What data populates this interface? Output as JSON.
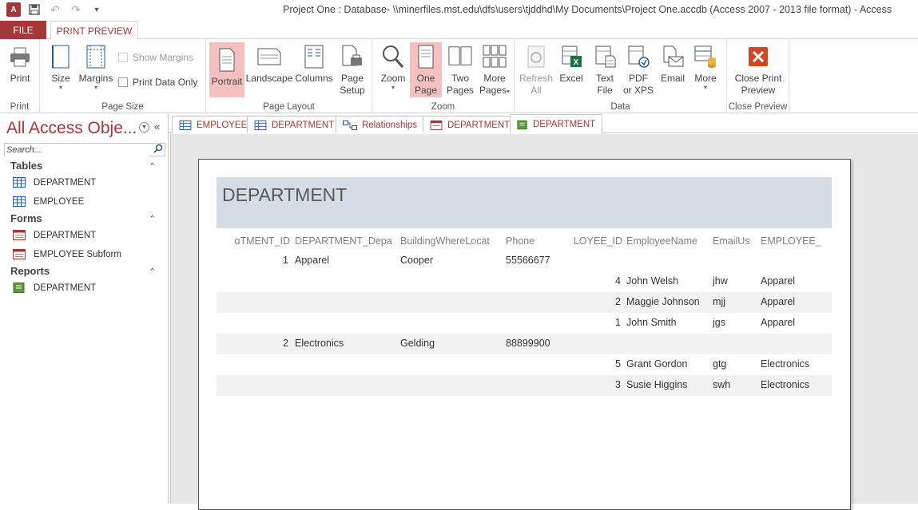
{
  "window": {
    "title": "Project One : Database- \\\\minerfiles.mst.edu\\dfs\\users\\tjddhd\\My Documents\\Project One.accdb (Access 2007 - 2013 file format) - Access",
    "app_icon_text": "A"
  },
  "ribbon_tabs": {
    "file": "FILE",
    "active": "PRINT PREVIEW"
  },
  "ribbon": {
    "print": {
      "button": "Print",
      "group": "Print"
    },
    "page_size": {
      "size": "Size",
      "margins": "Margins",
      "show_margins": "Show Margins",
      "print_data_only": "Print Data Only",
      "group": "Page Size"
    },
    "page_layout": {
      "portrait": "Portrait",
      "landscape": "Landscape",
      "columns": "Columns",
      "page_setup_1": "Page",
      "page_setup_2": "Setup",
      "group": "Page Layout"
    },
    "zoom": {
      "zoom": "Zoom",
      "one_page_1": "One",
      "one_page_2": "Page",
      "two_pages_1": "Two",
      "two_pages_2": "Pages",
      "more_pages_1": "More",
      "more_pages_2": "Pages",
      "group": "Zoom"
    },
    "data": {
      "refresh_1": "Refresh",
      "refresh_2": "All",
      "excel": "Excel",
      "text_file_1": "Text",
      "text_file_2": "File",
      "pdf_1": "PDF",
      "pdf_2": "or XPS",
      "email": "Email",
      "more": "More",
      "group": "Data"
    },
    "close": {
      "close_1": "Close Print",
      "close_2": "Preview",
      "group": "Close Preview"
    }
  },
  "nav": {
    "title": "All Access Obje...",
    "search_placeholder": "Search...",
    "sections": [
      {
        "header": "Tables",
        "items": [
          "DEPARTMENT",
          "EMPLOYEE"
        ]
      },
      {
        "header": "Forms",
        "items": [
          "DEPARTMENT",
          "EMPLOYEE Subform"
        ]
      },
      {
        "header": "Reports",
        "items": [
          "DEPARTMENT"
        ]
      }
    ]
  },
  "doc_tabs": [
    {
      "label": "EMPLOYEE",
      "icon": "table-icon"
    },
    {
      "label": "DEPARTMENT",
      "icon": "table-icon"
    },
    {
      "label": "Relationships",
      "icon": "relationships-icon"
    },
    {
      "label": "DEPARTMENT",
      "icon": "form-icon"
    },
    {
      "label": "DEPARTMENT",
      "icon": "report-icon"
    }
  ],
  "report": {
    "title": "DEPARTMENT",
    "columns": [
      "ɑTMENT_ID",
      "DEPARTMENT_Depa",
      "BuildingWhereLocat",
      "Phone",
      "LOYEE_ID",
      "EmployeeName",
      "EmailUs",
      "EMPLOYEE_"
    ],
    "rows": [
      {
        "dept_id": "1",
        "dept": "Apparel",
        "building": "Cooper",
        "phone": "55566677",
        "emp_id": "",
        "name": "",
        "email": "",
        "emp_dept": "",
        "shade": false
      },
      {
        "dept_id": "",
        "dept": "",
        "building": "",
        "phone": "",
        "emp_id": "4",
        "name": "John Welsh",
        "email": "jhw",
        "emp_dept": "Apparel",
        "shade": false
      },
      {
        "dept_id": "",
        "dept": "",
        "building": "",
        "phone": "",
        "emp_id": "2",
        "name": "Maggie Johnson",
        "email": "mjj",
        "emp_dept": "Apparel",
        "shade": true
      },
      {
        "dept_id": "",
        "dept": "",
        "building": "",
        "phone": "",
        "emp_id": "1",
        "name": "John Smith",
        "email": "jgs",
        "emp_dept": "Apparel",
        "shade": false
      },
      {
        "dept_id": "2",
        "dept": "Electronics",
        "building": "Gelding",
        "phone": "88899900",
        "emp_id": "",
        "name": "",
        "email": "",
        "emp_dept": "",
        "shade": true
      },
      {
        "dept_id": "",
        "dept": "",
        "building": "",
        "phone": "",
        "emp_id": "5",
        "name": "Grant Gordon",
        "email": "gtg",
        "emp_dept": "Electronics",
        "shade": false
      },
      {
        "dept_id": "",
        "dept": "",
        "building": "",
        "phone": "",
        "emp_id": "3",
        "name": "Susie Higgins",
        "email": "swh",
        "emp_dept": "Electronics",
        "shade": true
      }
    ]
  },
  "colors": {
    "accent": "#a4373a",
    "active_button": "#f4c0c0",
    "report_header": "#d6dce5",
    "row_shade": "#f2f2f2"
  }
}
